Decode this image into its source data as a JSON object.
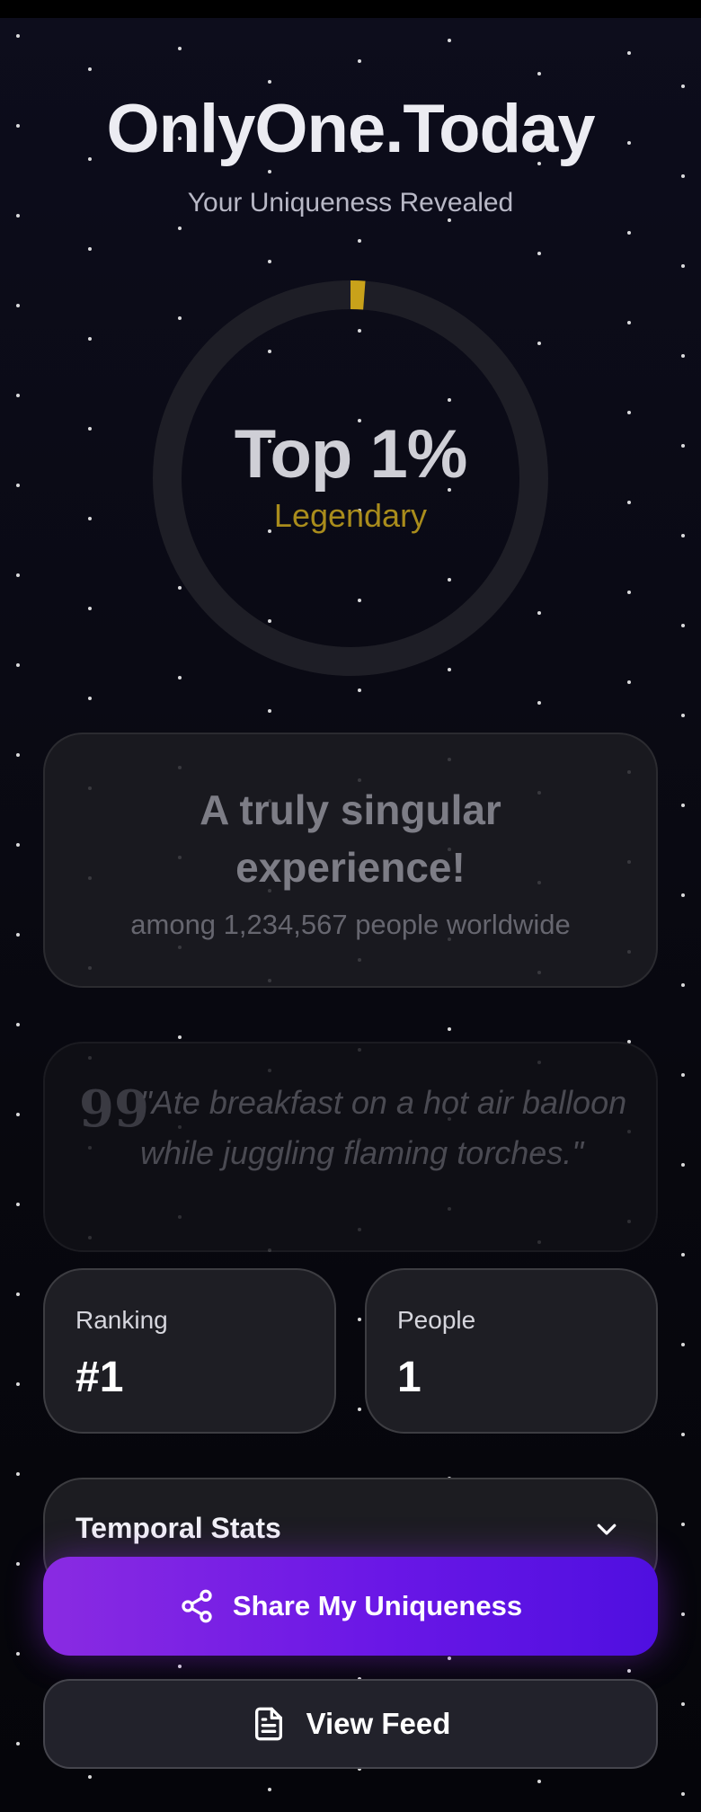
{
  "app": {
    "title": "OnlyOne.Today",
    "subtitle": "Your Uniqueness Revealed"
  },
  "result": {
    "rank_text": "Top 1%",
    "tier": "Legendary",
    "ring_progress": 0.01,
    "ring_color": "#c9a21a"
  },
  "message": {
    "title": "A truly singular experience!",
    "subtitle": "among 1,234,567 people worldwide"
  },
  "quote": {
    "icon": "quote-icon",
    "text": "\"Ate breakfast on a hot air balloon while juggling flaming torches.\""
  },
  "stats": {
    "ranking_label": "Ranking",
    "ranking_value": "#1",
    "people_label": "People",
    "people_value": "1"
  },
  "temporal": {
    "title": "Temporal Stats",
    "icon": "chevron-down-icon"
  },
  "actions": {
    "share_label": "Share My Uniqueness",
    "share_icon": "share-icon",
    "feed_label": "View Feed",
    "feed_icon": "document-icon"
  },
  "colors": {
    "accent_purple": "#8a2be2",
    "accent_violet": "#4f0fe0",
    "gold": "#c9a21a",
    "background": "#0b0b15"
  }
}
